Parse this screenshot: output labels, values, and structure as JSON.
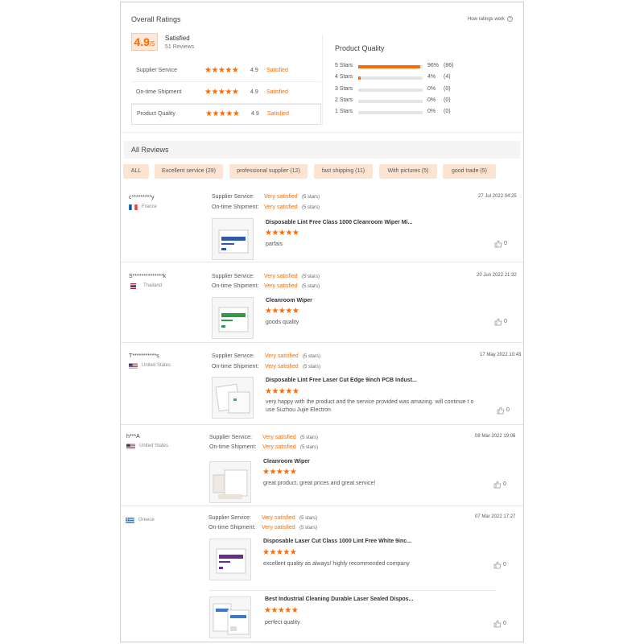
{
  "overall": {
    "title": "Overall Ratings",
    "how_link": "How ratings work",
    "score": "4.9",
    "score_suffix": "/5",
    "satisfaction": "Satisfied",
    "reviews_count": "51 Reviews",
    "ratings": [
      {
        "label": "Supplier Service",
        "score": "4.9",
        "status": "Satisfied",
        "stars": 5
      },
      {
        "label": "On-time Shipment",
        "score": "4.9",
        "status": "Satisfied",
        "stars": 5
      },
      {
        "label": "Product Quality",
        "score": "4.9",
        "status": "Satisfied",
        "stars": 5
      }
    ]
  },
  "product_quality": {
    "title": "Product Quality",
    "distribution": [
      {
        "label": "5 Stars",
        "percent": "96%",
        "count": "(86)",
        "fill": 0.96
      },
      {
        "label": "4 Stars",
        "percent": "4%",
        "count": "(4)",
        "fill": 0.04
      },
      {
        "label": "3 Stars",
        "percent": "0%",
        "count": "(0)",
        "fill": 0
      },
      {
        "label": "2 Stars",
        "percent": "0%",
        "count": "(0)",
        "fill": 0
      },
      {
        "label": "1 Stars",
        "percent": "0%",
        "count": "(0)",
        "fill": 0
      }
    ]
  },
  "all_reviews": {
    "title": "All Reviews",
    "filters": [
      "ALL",
      "Excellent service (29)",
      "professional supplier (12)",
      "fast shipping (11)",
      "With pictures (5)",
      "good trade (5)"
    ]
  },
  "labels": {
    "supplier_service": "Supplier Service:",
    "on_time_shipment": "On-time Shipment:",
    "stars_text": "(5 stars)"
  },
  "reviews": [
    {
      "user": "c*********y",
      "country": "France",
      "date": "27 Jul 2022 04:25",
      "supplier_service": "Very satisfied",
      "on_time_shipment": "Very satisfied",
      "items": [
        {
          "product": "Disposable Lint Free Class 1000 Cleanroom Wiper Mi...",
          "comment": "parfais",
          "likes": "0"
        }
      ]
    },
    {
      "user": "S**************k",
      "country": "Thailand",
      "date": "20 Jun 2022 21:32",
      "supplier_service": "Very satisfied",
      "on_time_shipment": "Very satisfied",
      "items": [
        {
          "product": "Cleanroom Wiper",
          "comment": "goods quality",
          "likes": "0"
        }
      ]
    },
    {
      "user": "T***********s",
      "country": "United States",
      "date": "17 May 2022 10:43",
      "supplier_service": "Very satisfied",
      "on_time_shipment": "Very satisfied",
      "items": [
        {
          "product": "Disposable Lint Free Laser Cut Edge 9inch PCB Indust...",
          "comment": "very happy with the product and the service provided was amazing. will continue t o use Suzhou Jujie Electron",
          "likes": "0"
        }
      ]
    },
    {
      "user": "h***A",
      "country": "United States",
      "date": "08 Mar 2022 19:06",
      "supplier_service": "Very satisfied",
      "on_time_shipment": "Very satisfied",
      "items": [
        {
          "product": "Cleanroom Wiper",
          "comment": "great product, great prices and great service!",
          "likes": "0"
        }
      ]
    },
    {
      "user": "",
      "country": "Greece",
      "date": "07 Mar 2022 17:27",
      "supplier_service": "Very satisfied",
      "on_time_shipment": "Very satisfied",
      "items": [
        {
          "product": "Disposable Laser Cut Class 1000 Lint Free White 9inc...",
          "comment": "excellent quality as always! highly recommended company",
          "likes": "0"
        },
        {
          "product": "Best Industrial Cleaning Durable Laser Sealed Dispos...",
          "comment": "perfect quality",
          "likes": "0"
        }
      ]
    }
  ],
  "colors": {
    "accent": "#ff6a00",
    "chip_bg": "#fde3d2",
    "score_bg": "#fde8d9"
  },
  "icons": {
    "like": "thumbs-up-icon",
    "help": "question-circle-icon",
    "star": "star-icon"
  }
}
